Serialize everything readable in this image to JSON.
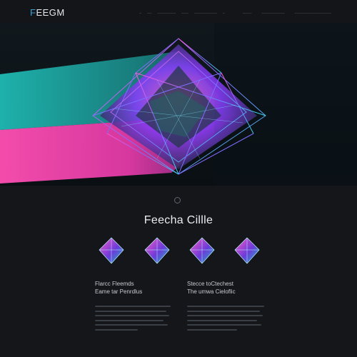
{
  "header": {
    "logo_first": "F",
    "logo_rest": "EEGM",
    "nav": [
      "—",
      "——",
      "————————",
      "———",
      "——————————",
      "—"
    ],
    "nav_right": [
      "————",
      "——————————",
      "————————————————"
    ]
  },
  "hero": {
    "accent_cyan": "#2ad1c9",
    "accent_pink": "#ff3fbf",
    "accent_violet": "#7b5cff"
  },
  "section": {
    "title": "Feecha Cillle"
  },
  "columns": [
    {
      "line1": "Flarcc Fleemds",
      "line2": "Eame tar Penrdlus"
    },
    {
      "line1": "Stecce toCtechest",
      "line2": "The umwa Cieloflic"
    }
  ],
  "icons": [
    "diamond-feature-icon",
    "diamond-feature-icon",
    "diamond-feature-icon",
    "diamond-feature-icon"
  ]
}
